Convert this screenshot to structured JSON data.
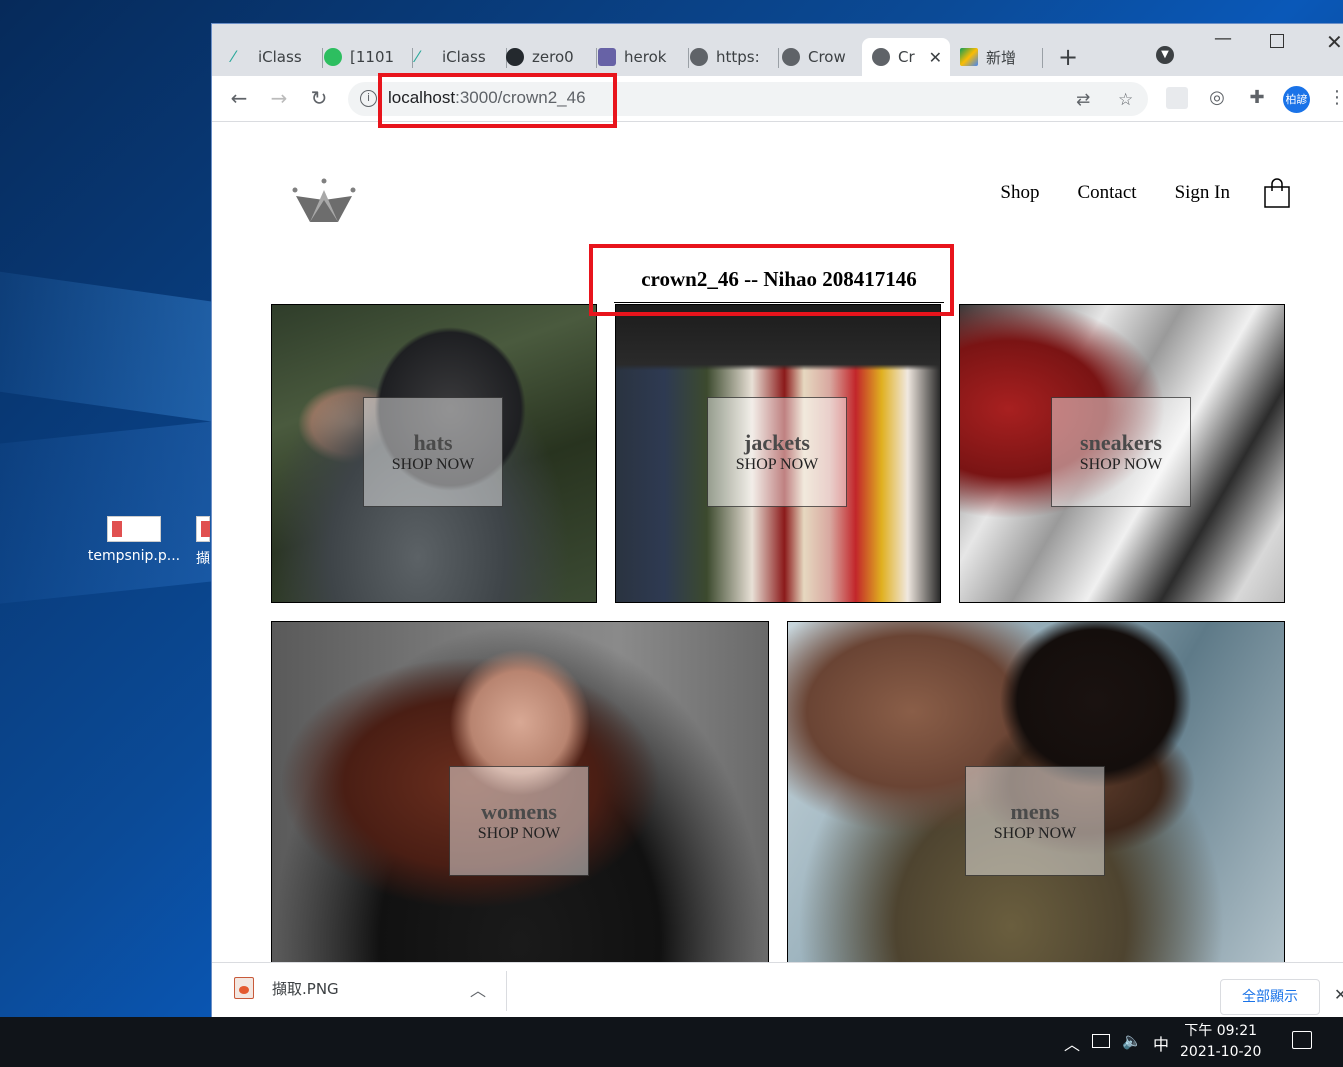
{
  "desktop": {
    "icons": [
      {
        "label": "tempsnip.p..."
      },
      {
        "label": "擷"
      }
    ]
  },
  "browser": {
    "tabs": [
      {
        "label": "iClass",
        "icon": "iclass-icon",
        "color": "#2aa89a"
      },
      {
        "label": "[1101",
        "icon": "evernote-icon",
        "color": "#2dbe60"
      },
      {
        "label": "iClass",
        "icon": "iclass-icon",
        "color": "#2aa89a"
      },
      {
        "label": "zero0",
        "icon": "github-icon",
        "color": "#24292e"
      },
      {
        "label": "herok",
        "icon": "heroku-icon",
        "color": "#6762a6"
      },
      {
        "label": "https:",
        "icon": "globe-icon",
        "color": "#5f6368"
      },
      {
        "label": "Crow",
        "icon": "globe-icon",
        "color": "#5f6368"
      },
      {
        "label": "Cr",
        "icon": "globe-icon",
        "color": "#5f6368",
        "active": true
      },
      {
        "label": "新增",
        "icon": "drive-icon",
        "color": "#fbbc04"
      }
    ],
    "new_tab": "+",
    "url_host": "localhost",
    "url_path": ":3000/crown2_46",
    "profile_initials": "柏諺"
  },
  "site": {
    "nav": {
      "shop": "Shop",
      "contact": "Contact",
      "sign_in": "Sign In"
    },
    "title": "crown2_46 -- Nihao 208417146",
    "sections": [
      {
        "name": "hats",
        "sub": "SHOP NOW"
      },
      {
        "name": "jackets",
        "sub": "SHOP NOW"
      },
      {
        "name": "sneakers",
        "sub": "SHOP NOW"
      },
      {
        "name": "womens",
        "sub": "SHOP NOW"
      },
      {
        "name": "mens",
        "sub": "SHOP NOW"
      }
    ]
  },
  "downloads": {
    "file": "擷取.PNG",
    "show_all": "全部顯示"
  },
  "taskbar": {
    "ime": "中",
    "time": "下午 09:21",
    "date": "2021-10-20"
  },
  "colors": {
    "highlight_box": "#e8141c",
    "link_blue": "#1a73e8"
  }
}
